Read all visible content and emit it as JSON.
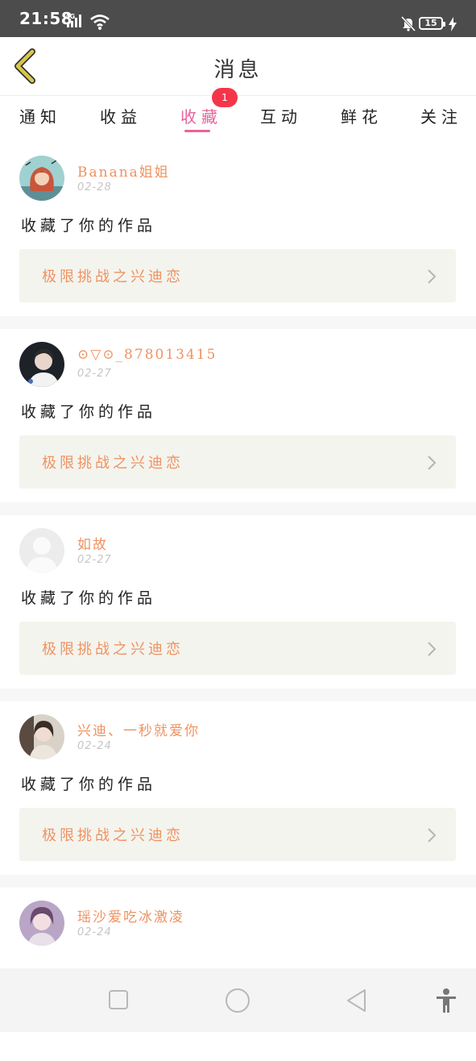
{
  "status_bar": {
    "time": "21:58",
    "network": "4G",
    "battery": "15"
  },
  "header": {
    "title": "消息"
  },
  "tabs": [
    {
      "label": "通知"
    },
    {
      "label": "收益"
    },
    {
      "label": "收藏",
      "active": true,
      "badge": "1"
    },
    {
      "label": "互动"
    },
    {
      "label": "鲜花"
    },
    {
      "label": "关注"
    }
  ],
  "messages": [
    {
      "username": "Banana姐姐",
      "date": "02-28",
      "action": "收藏了你的作品",
      "work": "极限挑战之兴迪恋",
      "avatar": "cartoon-avatar"
    },
    {
      "username": "⊙▽⊙_878013415",
      "date": "02-27",
      "action": "收藏了你的作品",
      "work": "极限挑战之兴迪恋",
      "avatar": "photo-avatar"
    },
    {
      "username": "如故",
      "date": "02-27",
      "action": "收藏了你的作品",
      "work": "极限挑战之兴迪恋",
      "avatar": "default-avatar"
    },
    {
      "username": "兴迪、一秒就爱你",
      "date": "02-24",
      "action": "收藏了你的作品",
      "work": "极限挑战之兴迪恋",
      "avatar": "photo-avatar"
    },
    {
      "username": "瑶沙爱吃冰激凌",
      "date": "02-24",
      "action": "",
      "work": "",
      "avatar": "photo-avatar"
    }
  ],
  "colors": {
    "accent": "#e8639b",
    "username": "#ef9261",
    "badge": "#f5354a",
    "back_arrow": "#d9c74a"
  }
}
